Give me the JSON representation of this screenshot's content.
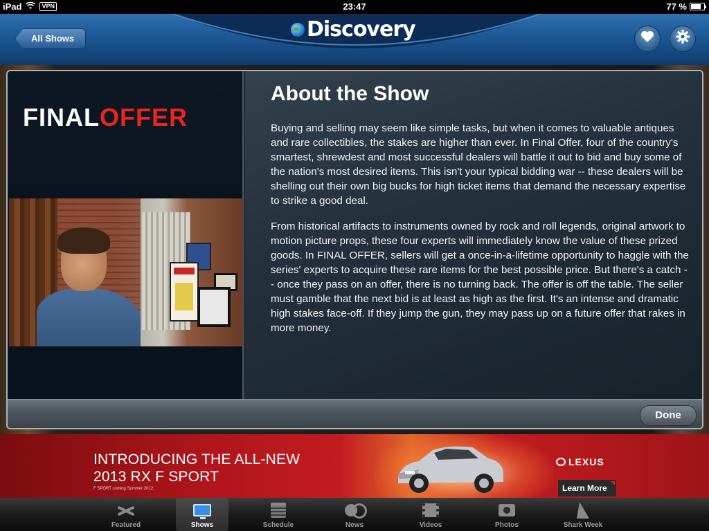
{
  "status_bar": {
    "device": "iPad",
    "vpn": "VPN",
    "time": "23:47",
    "battery": "77 %",
    "battery_level": 0.77
  },
  "header": {
    "back_label": "All Shows",
    "logo_text": "Discovery",
    "favorite_icon": "heart-icon",
    "settings_icon": "gear-icon"
  },
  "show": {
    "title_part1": "FINAL",
    "title_part2": "OFFER",
    "heading": "About the Show",
    "paragraphs": [
      "Buying and selling may seem like simple tasks, but when it comes to valuable antiques and rare collectibles, the stakes are higher than ever. In Final Offer, four of the country's smartest, shrewdest and most successful dealers will battle it out to bid and buy some of the nation's most desired items. This isn't your typical bidding war -- these dealers will be shelling out their own big bucks for high ticket items that demand the necessary expertise to strike a good deal.",
      "From historical artifacts to instruments owned by rock and roll legends, original artwork to motion picture props, these four experts will immediately know the value of these prized goods. In FINAL OFFER, sellers will get a once-in-a-lifetime opportunity to haggle with the series' experts to acquire these rare items for the best possible price. But there's a catch -- once they pass on an offer, there is no turning back. The offer is off the table. The seller must gamble that the next bid is at least as high as the first. It's an intense and dramatic high stakes face-off. If they jump the gun, they may pass up on a future offer that rakes in more money."
    ],
    "done_label": "Done"
  },
  "ad": {
    "headline_line1": "INTRODUCING THE ALL-NEW",
    "headline_line2": "2013 RX F SPORT",
    "fine_print": "F SPORT coming Summer 2012.",
    "brand": "LEXUS",
    "cta": "Learn More"
  },
  "tabs": [
    {
      "label": "Featured",
      "icon": "featured-icon",
      "active": false
    },
    {
      "label": "Shows",
      "icon": "tv-icon",
      "active": true
    },
    {
      "label": "Schedule",
      "icon": "calendar-icon",
      "active": false
    },
    {
      "label": "News",
      "icon": "news-icon",
      "active": false
    },
    {
      "label": "Videos",
      "icon": "film-icon",
      "active": false
    },
    {
      "label": "Photos",
      "icon": "camera-icon",
      "active": false
    },
    {
      "label": "Shark Week",
      "icon": "shark-fin-icon",
      "active": false
    }
  ]
}
